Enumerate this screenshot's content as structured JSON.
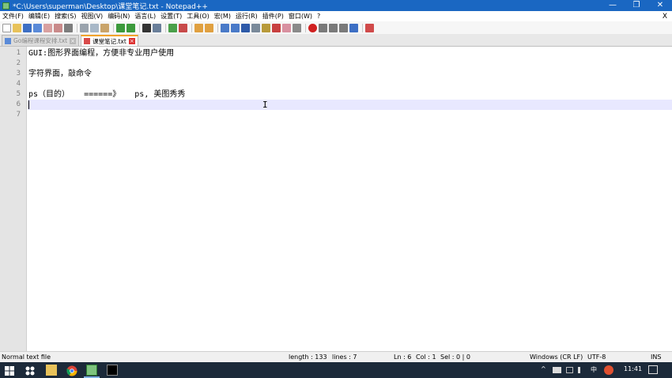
{
  "window": {
    "title": "*C:\\Users\\superman\\Desktop\\课堂笔记.txt - Notepad++",
    "minimize": "—",
    "restore": "❐",
    "close": "✕"
  },
  "menu": {
    "items": [
      "文件(F)",
      "编辑(E)",
      "搜索(S)",
      "视图(V)",
      "编码(N)",
      "语言(L)",
      "设置(T)",
      "工具(O)",
      "宏(M)",
      "运行(R)",
      "插件(P)",
      "窗口(W)",
      "?"
    ],
    "close_label": "X"
  },
  "tabs": [
    {
      "label": "Go编程课程安排.txt",
      "active": false,
      "close": "×"
    },
    {
      "label": "课堂笔记.txt",
      "active": true,
      "close": "×"
    }
  ],
  "editor": {
    "line_numbers": [
      "1",
      "2",
      "3",
      "4",
      "5",
      "6",
      "7"
    ],
    "lines": [
      "GUI:图形界面编程，方便非专业用户使用",
      "",
      "字符界面，敲命令",
      "",
      "ps（目的）   ======》   ps, 美图秀秀",
      "",
      ""
    ],
    "current_line": 6,
    "cursor_glyph": "I"
  },
  "status": {
    "file_type": "Normal text file",
    "length": "length : 133",
    "lines": "lines : 7",
    "ln": "Ln : 6",
    "col": "Col : 1",
    "sel": "Sel : 0 | 0",
    "eol": "Windows (CR LF)",
    "encoding": "UTF-8",
    "mode": "INS"
  },
  "taskbar": {
    "tray_icons": "^",
    "input_method": "中",
    "clock": "11:41"
  },
  "colors": {
    "titlebar": "#1a67c2",
    "current_line": "#e8e8ff",
    "active_tab_accent": "#f3a32a",
    "taskbar": "#1c2a3a"
  }
}
